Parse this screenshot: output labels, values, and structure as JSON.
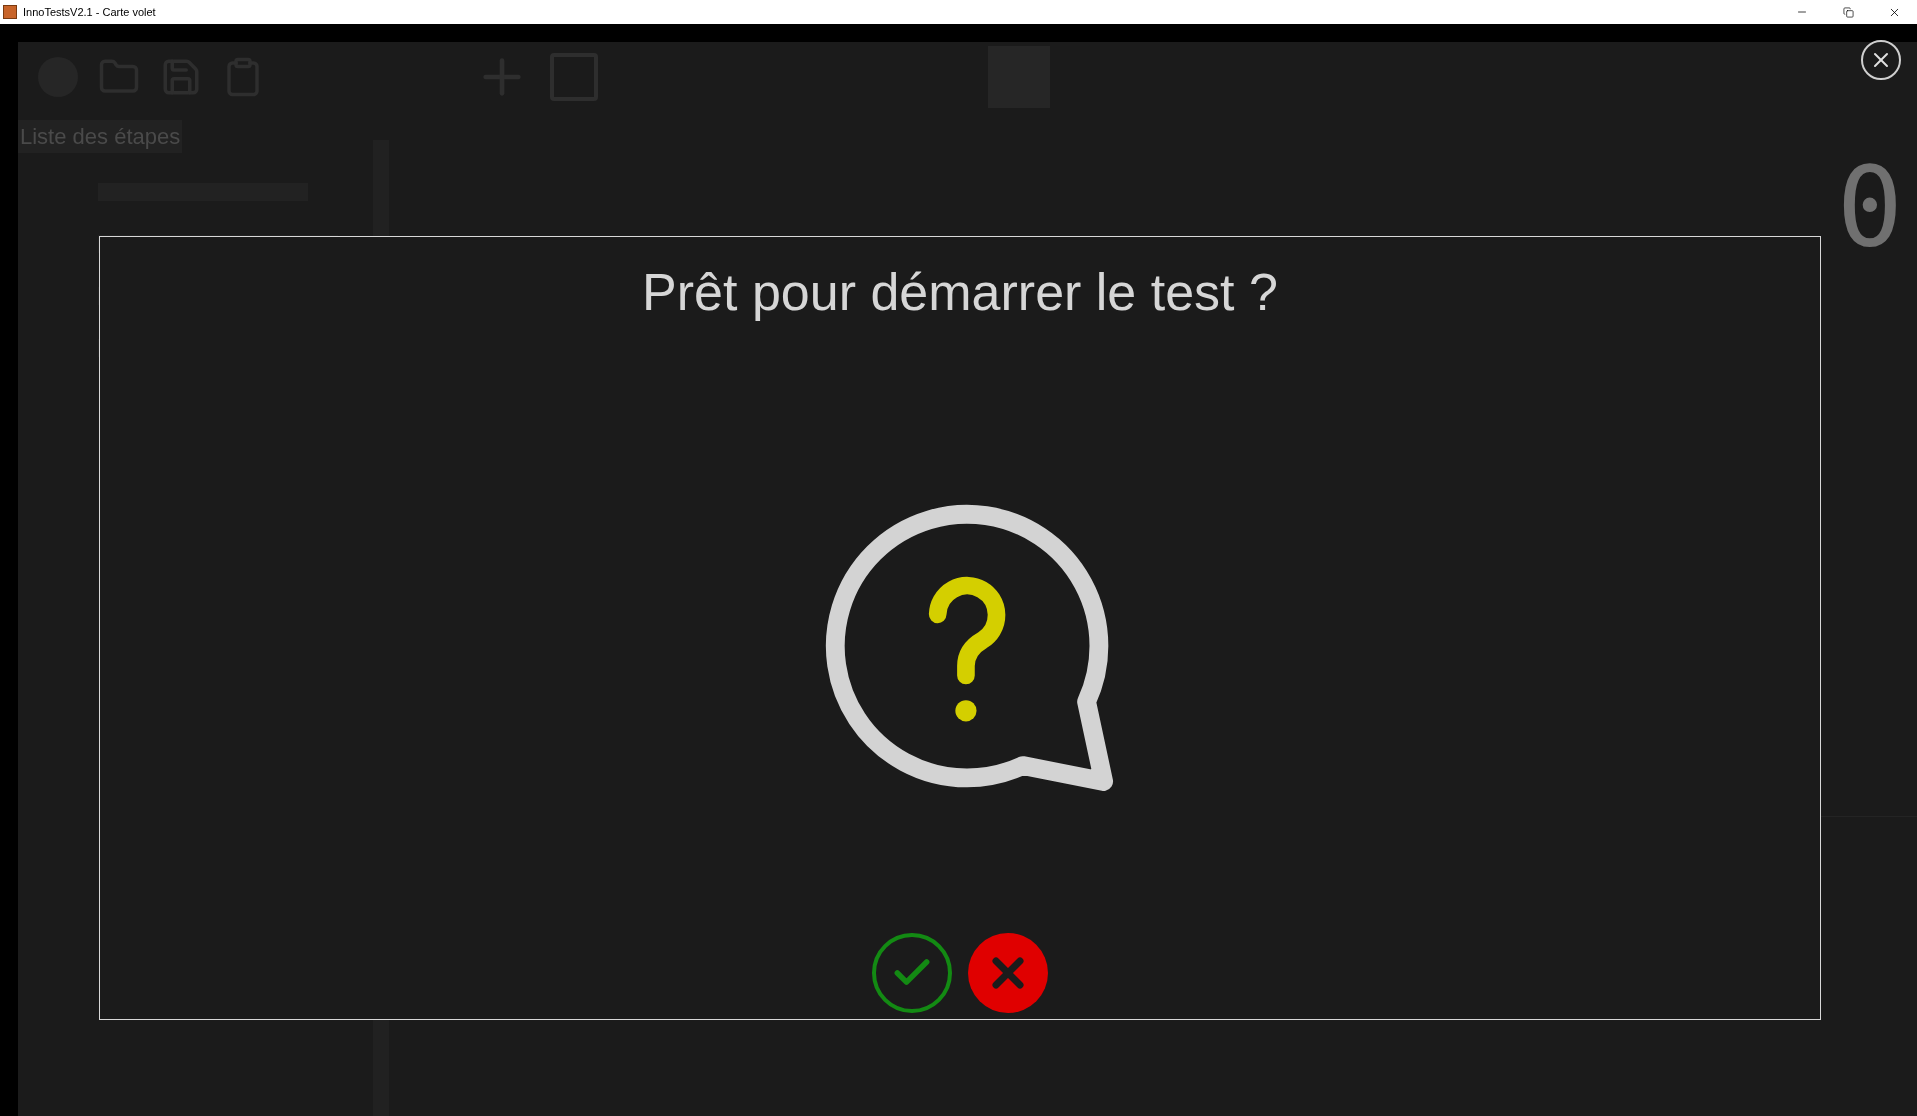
{
  "window": {
    "title": "InnoTestsV2.1 - Carte volet"
  },
  "background": {
    "steps_heading": "Liste des étapes",
    "counter": "0"
  },
  "dialog": {
    "title": "Prêt pour démarrer le test ?",
    "buttons": [
      {
        "kind": "confirm"
      },
      {
        "kind": "cancel"
      }
    ]
  }
}
